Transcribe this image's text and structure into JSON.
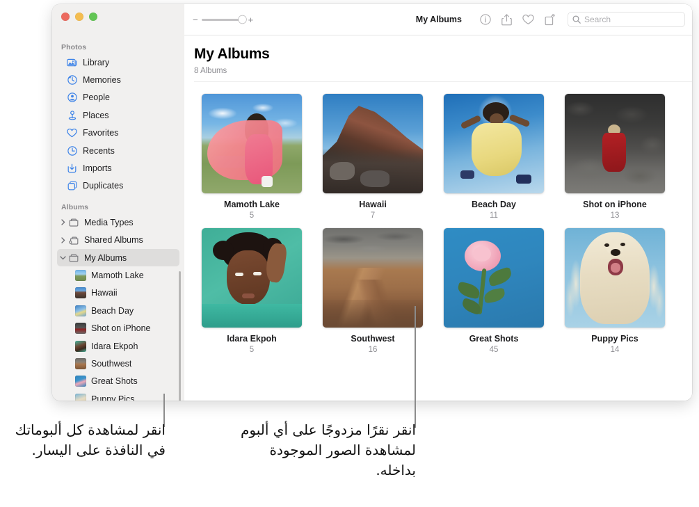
{
  "window": {
    "traffic_lights": [
      {
        "name": "close",
        "color": "#ec6a5f"
      },
      {
        "name": "minimize",
        "color": "#f4bd50"
      },
      {
        "name": "maximize",
        "color": "#62c554"
      }
    ]
  },
  "sidebar": {
    "groups": [
      {
        "title": "Photos",
        "items": [
          {
            "label": "Library",
            "icon": "library-icon"
          },
          {
            "label": "Memories",
            "icon": "memories-icon"
          },
          {
            "label": "People",
            "icon": "people-icon"
          },
          {
            "label": "Places",
            "icon": "places-icon"
          },
          {
            "label": "Favorites",
            "icon": "heart-icon"
          },
          {
            "label": "Recents",
            "icon": "clock-icon"
          },
          {
            "label": "Imports",
            "icon": "import-icon"
          },
          {
            "label": "Duplicates",
            "icon": "duplicates-icon"
          }
        ]
      },
      {
        "title": "Albums",
        "items": [
          {
            "label": "Media Types",
            "icon": "folder-icon",
            "disclosure": "collapsed"
          },
          {
            "label": "Shared Albums",
            "icon": "shared-folder-icon",
            "disclosure": "collapsed"
          },
          {
            "label": "My Albums",
            "icon": "folder-icon",
            "disclosure": "expanded",
            "selected": true
          },
          {
            "label": "Mamoth Lake",
            "thumb": "mamoth-lake",
            "child": true
          },
          {
            "label": "Hawaii",
            "thumb": "hawaii",
            "child": true
          },
          {
            "label": "Beach Day",
            "thumb": "beach-day",
            "child": true
          },
          {
            "label": "Shot on iPhone",
            "thumb": "shot-on-iphone",
            "child": true
          },
          {
            "label": "Idara Ekpoh",
            "thumb": "idara-ekpoh",
            "child": true
          },
          {
            "label": "Southwest",
            "thumb": "southwest",
            "child": true
          },
          {
            "label": "Great Shots",
            "thumb": "great-shots",
            "child": true
          },
          {
            "label": "Puppy Pics",
            "thumb": "puppy-pics",
            "child": true
          }
        ]
      }
    ]
  },
  "toolbar": {
    "zoom_minus": "−",
    "zoom_plus": "+",
    "title": "My Albums",
    "icons": [
      {
        "name": "info-icon",
        "glyph": "info"
      },
      {
        "name": "share-icon",
        "glyph": "share"
      },
      {
        "name": "favorite-heart-icon",
        "glyph": "heart"
      },
      {
        "name": "rotate-icon",
        "glyph": "rotate"
      }
    ],
    "search": {
      "placeholder": "Search",
      "value": "",
      "icon": "search-icon"
    }
  },
  "main": {
    "title": "My Albums",
    "subtitle": "8 Albums",
    "albums": [
      {
        "name": "Mamoth Lake",
        "count": "5",
        "thumb": "mamoth-lake"
      },
      {
        "name": "Hawaii",
        "count": "7",
        "thumb": "hawaii"
      },
      {
        "name": "Beach Day",
        "count": "11",
        "thumb": "beach-day"
      },
      {
        "name": "Shot on iPhone",
        "count": "13",
        "thumb": "shot-on-iphone"
      },
      {
        "name": "Idara Ekpoh",
        "count": "5",
        "thumb": "idara-ekpoh"
      },
      {
        "name": "Southwest",
        "count": "16",
        "thumb": "southwest"
      },
      {
        "name": "Great Shots",
        "count": "45",
        "thumb": "great-shots"
      },
      {
        "name": "Puppy Pics",
        "count": "14",
        "thumb": "puppy-pics"
      }
    ]
  },
  "callouts": {
    "left": "انقر لمشاهدة كل ألبوماتك في النافذة على اليسار.",
    "right": "انقر نقرًا مزدوجًا على أي ألبوم لمشاهدة الصور الموجودة بداخله."
  }
}
